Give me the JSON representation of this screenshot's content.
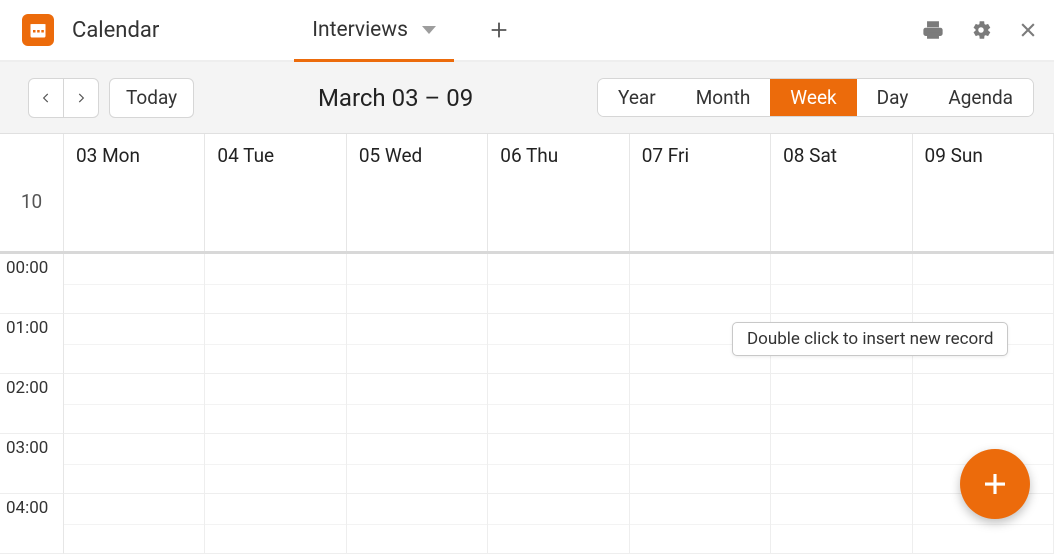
{
  "header": {
    "appTitle": "Calendar",
    "tab": {
      "label": "Interviews"
    }
  },
  "toolbar": {
    "todayLabel": "Today",
    "rangeTitle": "March 03 – 09",
    "views": {
      "year": "Year",
      "month": "Month",
      "week": "Week",
      "day": "Day",
      "agenda": "Agenda"
    },
    "activeView": "week"
  },
  "week": {
    "weekNumber": "10",
    "days": [
      "03 Mon",
      "04 Tue",
      "05 Wed",
      "06 Thu",
      "07 Fri",
      "08 Sat",
      "09 Sun"
    ],
    "hours": [
      "00:00",
      "01:00",
      "02:00",
      "03:00",
      "04:00"
    ]
  },
  "tooltip": "Double click to insert new record"
}
